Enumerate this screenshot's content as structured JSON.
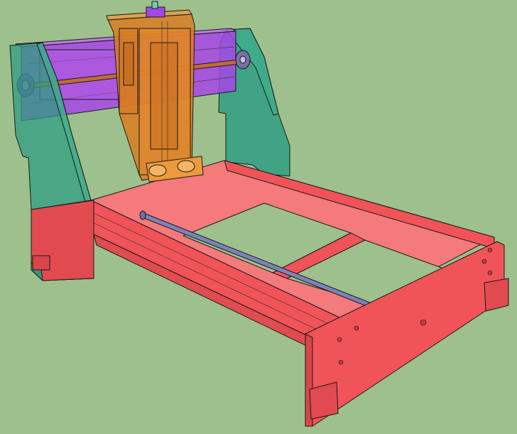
{
  "scene": {
    "background_color": "#9ec08c",
    "colors": {
      "frame": "#f05458",
      "frame_light": "#f47a7c",
      "frame_dark": "#d8454a",
      "side_panel": "#2e9e82",
      "side_panel_glass": "#3fae8f",
      "x_carriage": "#a646e6",
      "x_carriage_light": "#c06cf0",
      "z_assembly": "#d97b22",
      "z_assembly_light": "#eb9a3c",
      "lead_screw": "#8a6a8a",
      "rail_rod": "#7d83b8",
      "motor_mount": "#8a2cc8"
    },
    "components": [
      "left-side-plate",
      "right-side-plate",
      "x-axis-carriage",
      "x-lead-screw",
      "z-axis-assembly",
      "spindle-clamp",
      "base-frame",
      "y-rail-rod",
      "front-end-plate",
      "rear-end-plate"
    ]
  }
}
